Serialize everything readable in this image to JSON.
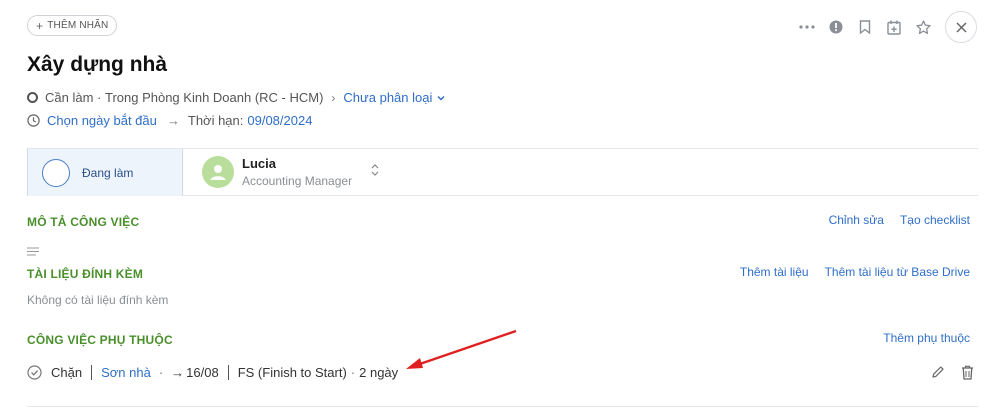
{
  "header": {
    "add_tag_label": "THÊM NHÃN",
    "icons": [
      "more-icon",
      "alert-icon",
      "bookmark-icon",
      "calendar-add-icon",
      "star-icon",
      "close-icon"
    ]
  },
  "task": {
    "title": "Xây dựng nhà",
    "status_text": "Cần làm",
    "location": "Trong Phòng Kinh Doanh (RC - HCM)",
    "category": "Chưa phân loại",
    "start_date": "Chọn ngày bắt đầu",
    "deadline_label": "Thời hạn:",
    "deadline": "09/08/2024"
  },
  "status_bar": {
    "state": "Đang làm",
    "assignee_name": "Lucia",
    "assignee_role": "Accounting Manager"
  },
  "description": {
    "heading": "MÔ TẢ CÔNG VIỆC",
    "edit_label": "Chỉnh sửa",
    "checklist_label": "Tạo checklist"
  },
  "attachments": {
    "heading": "TÀI LIỆU ĐÍNH KÈM",
    "add_label": "Thêm tài liệu",
    "add_drive_label": "Thêm tài liệu từ Base Drive",
    "empty_text": "Không có tài liệu đính kèm"
  },
  "dependencies": {
    "heading": "CÔNG VIỆC PHỤ THUỘC",
    "add_label": "Thêm phụ thuộc",
    "items": [
      {
        "type": "Chặn",
        "task": "Sơn nhà",
        "date": "16/08",
        "relation": "FS (Finish to Start)",
        "lag": "2 ngày"
      }
    ]
  },
  "colors": {
    "accent": "#2f6ec8",
    "section_heading": "#4a8f2c",
    "annotation_arrow": "#e02020"
  }
}
